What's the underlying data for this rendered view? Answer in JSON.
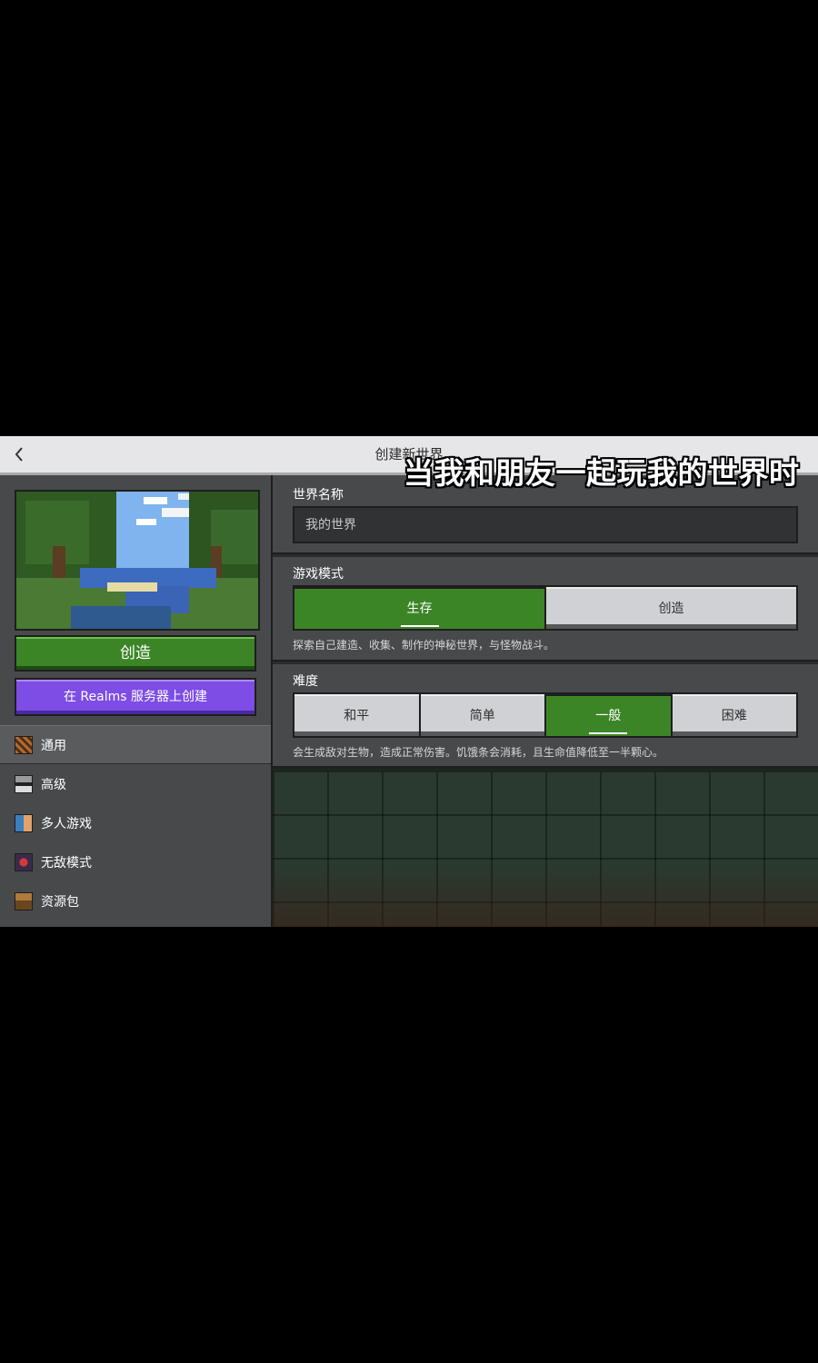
{
  "header": {
    "title": "创建新世界",
    "back_icon": "chevron-left-icon"
  },
  "overlay_caption": "当我和朋友一起玩我的世界时",
  "left_panel": {
    "create_label": "创造",
    "realms_label": "在 Realms 服务器上创建",
    "nav": [
      {
        "label": "通用",
        "icon": "general-icon",
        "active": true
      },
      {
        "label": "高级",
        "icon": "advanced-icon",
        "active": false
      },
      {
        "label": "多人游戏",
        "icon": "multiplayer-icon",
        "active": false
      },
      {
        "label": "无敌模式",
        "icon": "cheats-icon",
        "active": false
      },
      {
        "label": "资源包",
        "icon": "resource-pack-icon",
        "active": false
      }
    ]
  },
  "world_name": {
    "label": "世界名称",
    "value": "我的世界"
  },
  "game_mode": {
    "label": "游戏模式",
    "options": [
      "生存",
      "创造"
    ],
    "selected": "生存",
    "description": "探索自己建造、收集、制作的神秘世界，与怪物战斗。"
  },
  "difficulty": {
    "label": "难度",
    "options": [
      "和平",
      "简单",
      "一般",
      "困难"
    ],
    "selected": "一般",
    "description": "会生成敌对生物，造成正常伤害。饥饿条会消耗，且生命值降低至一半颗心。"
  },
  "colors": {
    "accent_green": "#3c8527",
    "realms_purple": "#7e4de6",
    "panel_gray": "#48494a"
  }
}
